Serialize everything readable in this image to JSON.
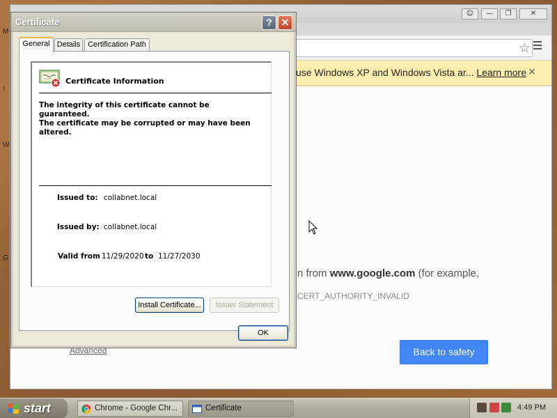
{
  "chrome": {
    "infobar_text": "use Windows XP and Windows Vista ar...",
    "infobar_link": "Learn more",
    "infobar_close": "×",
    "content_prefix": "n from ",
    "content_domain": "www.google.com",
    "content_suffix": " (for example,",
    "error_code": "CERT_AUTHORITY_INVALID",
    "advanced_link": "Advanced",
    "back_button": "Back to safety"
  },
  "dialog": {
    "title": "Certificate",
    "help_label": "?",
    "close_label": "✕",
    "tabs": [
      {
        "label": "General",
        "active": true
      },
      {
        "label": "Details",
        "active": false
      },
      {
        "label": "Certification Path",
        "active": false
      }
    ],
    "heading": "Certificate Information",
    "warning_lines": [
      "The integrity of this certificate cannot be guaranteed.",
      "The certificate may be corrupted or may have been",
      "altered."
    ],
    "issued_to_label": "Issued to:",
    "issued_to_value": "collabnet.local",
    "issued_by_label": "Issued by:",
    "issued_by_value": "collabnet.local",
    "valid_from_label": "Valid from",
    "valid_from_value": "11/29/2020",
    "valid_to_label": "to",
    "valid_to_value": "11/27/2030",
    "install_button": "Install Certificate...",
    "issuer_button": "Issuer Statement",
    "ok_button": "OK"
  },
  "taskbar": {
    "start_label": "start",
    "tasks": [
      {
        "label": "Chrome - Google Chr...",
        "active": false
      },
      {
        "label": "Certificate",
        "active": true
      }
    ],
    "clock": "4:49 PM"
  },
  "colors": {
    "infobar_bg": "#fbeeaf",
    "safety_button": "#4285f4",
    "dialog_bg": "#ece9d8",
    "close_button": "#c1452a"
  }
}
